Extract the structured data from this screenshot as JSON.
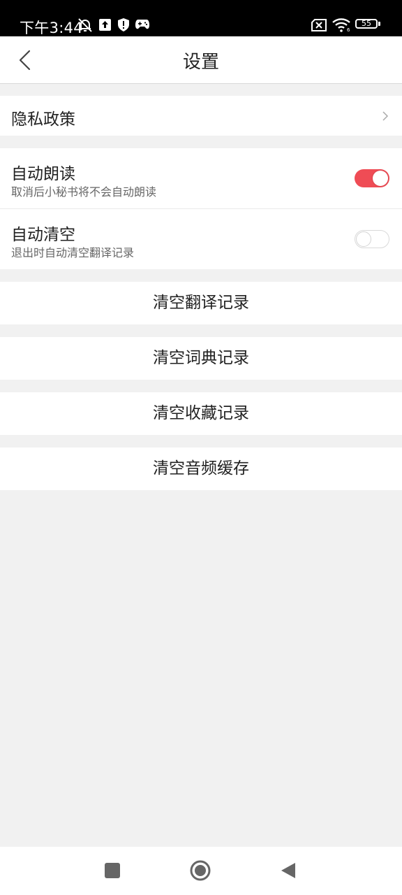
{
  "status_bar": {
    "time": "下午3:44",
    "battery_level": "55",
    "icons": [
      "mute-icon",
      "upload-icon",
      "shield-icon",
      "game-controller-icon",
      "sim-error-icon",
      "wifi-icon",
      "battery-icon"
    ]
  },
  "header": {
    "title": "设置",
    "back_icon": "chevron-left-icon"
  },
  "privacy": {
    "label": "隐私政策",
    "icon": "chevron-right-icon"
  },
  "settings": {
    "auto_read": {
      "title": "自动朗读",
      "subtitle": "取消后小秘书将不会自动朗读",
      "enabled": true
    },
    "auto_clear": {
      "title": "自动清空",
      "subtitle": "退出时自动清空翻译记录",
      "enabled": false
    }
  },
  "actions": {
    "clear_translation": "清空翻译记录",
    "clear_dictionary": "清空词典记录",
    "clear_favorites": "清空收藏记录",
    "clear_audio_cache": "清空音频缓存"
  },
  "colors": {
    "accent": "#ef4c55",
    "background": "#f1f1f1",
    "status_bar": "#000000"
  },
  "nav_bar": {
    "icons": [
      "recents-square-icon",
      "home-circle-icon",
      "back-triangle-icon"
    ]
  }
}
